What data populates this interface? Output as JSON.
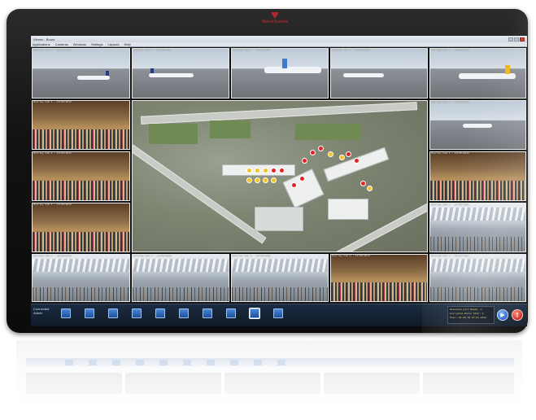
{
  "brand": {
    "name": "WatchSystem"
  },
  "window": {
    "title": "Viewer - Board"
  },
  "menu": [
    "Applications",
    "Cameras",
    "Windows",
    "Settings",
    "Layouts",
    "Help"
  ],
  "tiles": {
    "caption": "Overlay Cam 1 - 12/05/2012"
  },
  "bottom": {
    "connection": "Connected",
    "connection_sub": "Admin",
    "status_lines": [
      "Baseband port Ready: 4",
      "Encrypted Route Stat: 0",
      "Pose: 04:06:38 07-01-2012"
    ],
    "quick_buttons_count": 10,
    "active_quick_button": 9
  },
  "icons": {
    "play": "play-icon",
    "alert": "alert-icon",
    "brand": "brand-logo-icon"
  },
  "colors": {
    "accent": "#1f4f99",
    "alert": "#c91d12",
    "marker_yellow": "#f2c22a",
    "marker_red": "#e02424",
    "status_text": "#d9d06a"
  }
}
